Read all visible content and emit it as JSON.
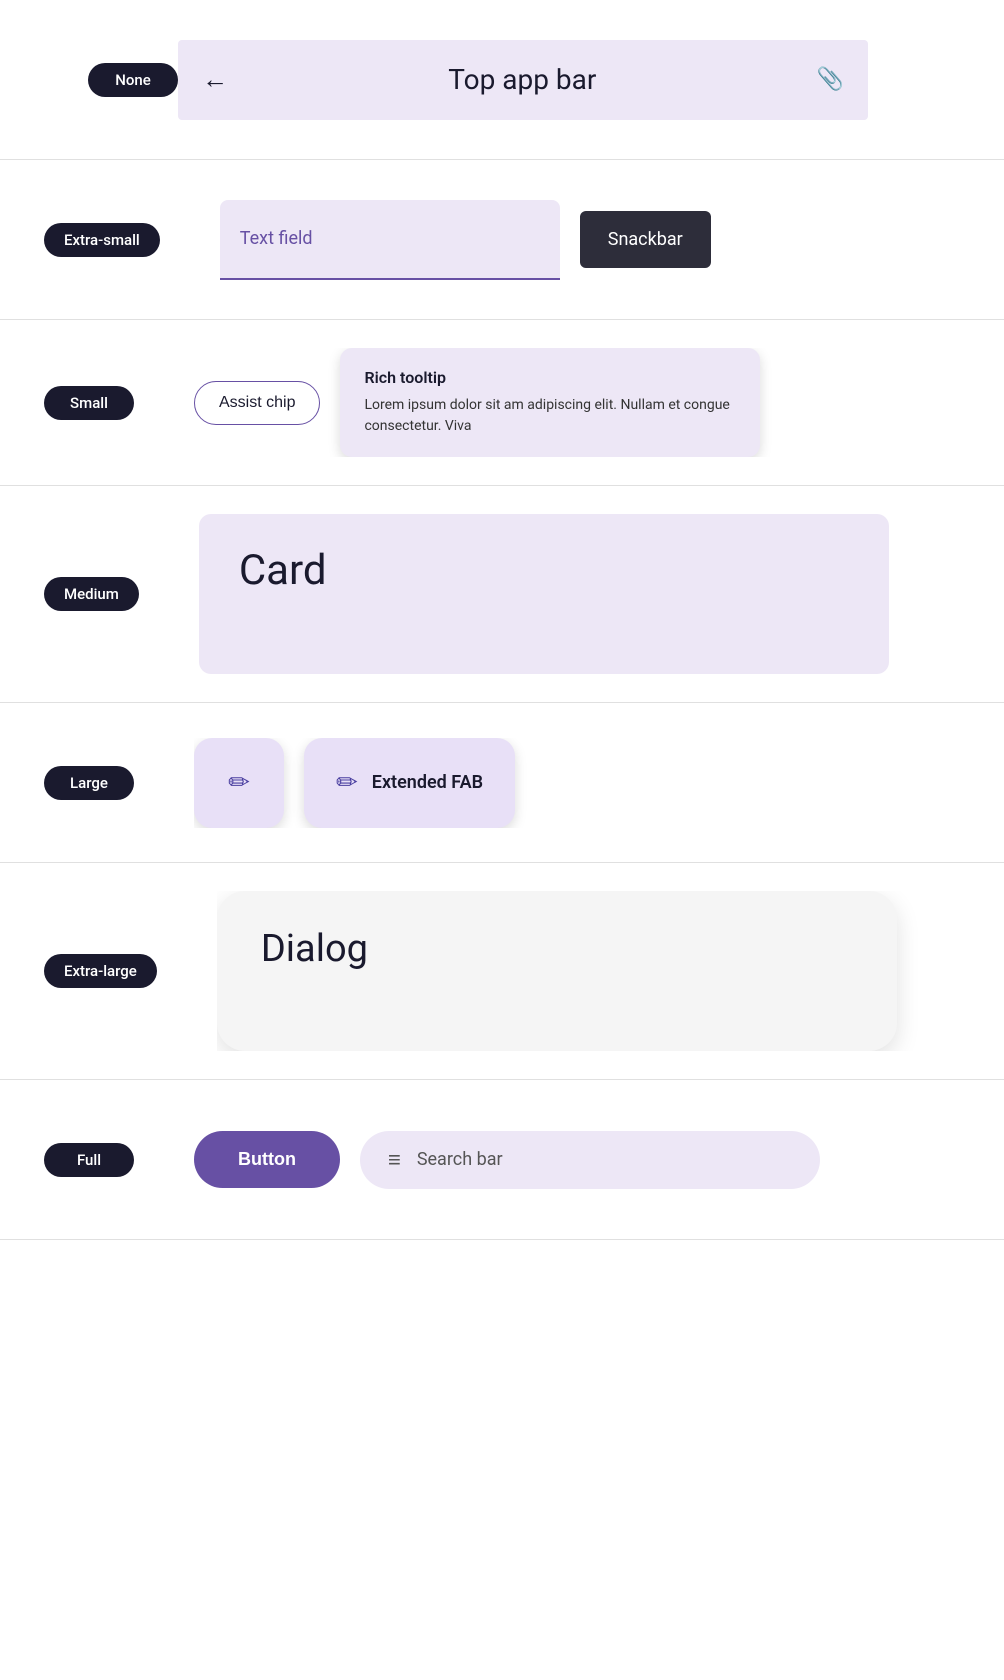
{
  "rows": [
    {
      "id": "none",
      "size_label": "None",
      "content_type": "top-app-bar",
      "top_app_bar": {
        "back_icon": "←",
        "title": "Top app bar",
        "attach_icon": "📎"
      }
    },
    {
      "id": "extra-small",
      "size_label": "Extra-small",
      "content_type": "text-field-snackbar",
      "text_field": {
        "label": "Text field"
      },
      "snackbar": {
        "label": "Snackbar"
      }
    },
    {
      "id": "small",
      "size_label": "Small",
      "content_type": "assist-chip-tooltip",
      "assist_chip": {
        "label": "Assist chip"
      },
      "rich_tooltip": {
        "title": "Rich tooltip",
        "body": "Lorem ipsum dolor sit am adipiscing elit. Nullam et congue consectetur. Viva"
      }
    },
    {
      "id": "medium",
      "size_label": "Medium",
      "content_type": "card",
      "card": {
        "title": "Card"
      }
    },
    {
      "id": "large",
      "size_label": "Large",
      "content_type": "fab-extended-fab",
      "fab": {
        "icon": "✏"
      },
      "extended_fab": {
        "icon": "✏",
        "label": "Extended FAB"
      }
    },
    {
      "id": "extra-large",
      "size_label": "Extra-large",
      "content_type": "dialog",
      "dialog": {
        "title": "Dialog"
      }
    },
    {
      "id": "full",
      "size_label": "Full",
      "content_type": "button-search",
      "button": {
        "label": "Button"
      },
      "search_bar": {
        "icon": "≡",
        "label": "Search bar"
      }
    }
  ]
}
